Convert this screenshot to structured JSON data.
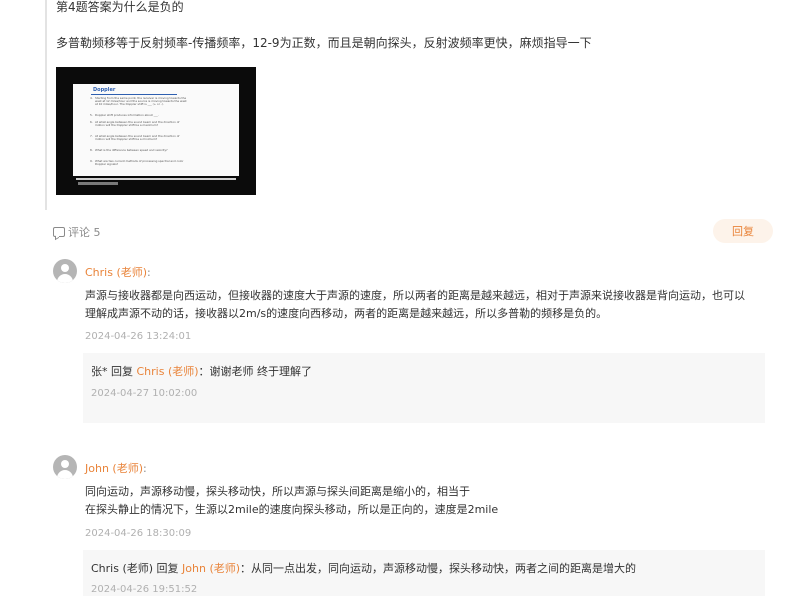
{
  "post": {
    "title": "第4题答案为什么是负的",
    "text": "多普勒频移等于反射频率-传播频率，12-9为正数，而且是朝向探头，反射波频率更快，麻烦指导一下",
    "image": {
      "slide_title": "Doppler",
      "items": [
        {
          "n": "4.",
          "text": "Starting from the same point, the receiver is moving towards the west at 12 miles/hour and the source is moving towards the west at 10 miles/hour. The Doppler shift is ___ (+ or -)."
        },
        {
          "n": "5.",
          "text": "Doppler shift produces information about ___."
        },
        {
          "n": "6.",
          "text": "At what angle between the sound beam and the direction of motion will the Doppler shift be a maximum?"
        },
        {
          "n": "7.",
          "text": "At what angle between the sound beam and the direction of motion will the Doppler shift be a minimum?"
        },
        {
          "n": "8.",
          "text": "What is the difference between speed and velocity?"
        },
        {
          "n": "9.",
          "text": "What are two current methods of processing spectral and color Doppler signals?"
        }
      ]
    }
  },
  "comments_meta": {
    "label": "评论 5",
    "reply_button": "回复"
  },
  "comments": [
    {
      "author": "Chris (老师)",
      "colon": ":",
      "lines": [
        "声源与接收器都是向西运动，但接收器的速度大于声源的速度，所以两者的距离是越来越远，相对于声源来说接收器是背向运动，也可以",
        "理解成声源不动的话，接收器以2m/s的速度向西移动，两者的距离是越来越远，所以多普勒的频移是负的。"
      ],
      "time": "2024-04-26 13:24:01",
      "reply": {
        "from": "张*",
        "verb": " 回复 ",
        "to": "Chris (老师)",
        "text": "：谢谢老师 终于理解了",
        "time": "2024-04-27 10:02:00"
      }
    },
    {
      "author": "John (老师)",
      "colon": ":",
      "lines": [
        "同向运动，声源移动慢，探头移动快，所以声源与探头间距离是缩小的，相当于",
        "在探头静止的情况下，生源以2mile的速度向探头移动，所以是正向的，速度是2mile"
      ],
      "time": "2024-04-26 18:30:09",
      "reply": {
        "from": "Chris (老师)",
        "verb": " 回复 ",
        "to": "John (老师)",
        "text": "：从同一点出发，同向运动，声源移动慢，探头移动快，两者之间的距离是增大的",
        "time": "2024-04-26 19:51:52"
      }
    }
  ]
}
